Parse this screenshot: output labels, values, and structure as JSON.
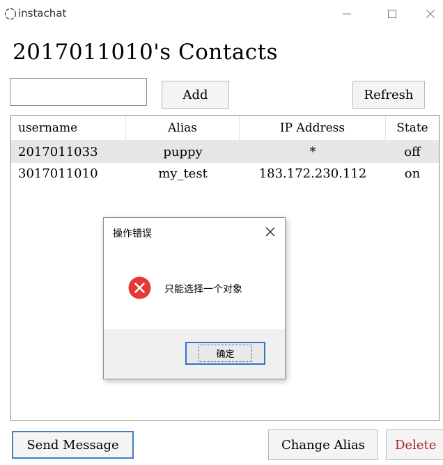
{
  "window": {
    "title": "instachat",
    "icon": "app-ring-icon",
    "controls": {
      "minimize": "minimize-icon",
      "maximize": "maximize-icon",
      "close": "close-icon"
    }
  },
  "page": {
    "title": "2017011010's Contacts"
  },
  "toolbar": {
    "input_value": "",
    "add_label": "Add",
    "refresh_label": "Refresh"
  },
  "table": {
    "headers": [
      "username",
      "Alias",
      "IP Address",
      "State"
    ],
    "rows": [
      {
        "username": "2017011033",
        "alias": "puppy",
        "ip": "*",
        "state": "off",
        "selected": true
      },
      {
        "username": "3017011010",
        "alias": "my_test",
        "ip": "183.172.230.112",
        "state": "on",
        "selected": false
      }
    ]
  },
  "actions": {
    "send_label": "Send Message",
    "change_alias_label": "Change Alias",
    "delete_label": "Delete"
  },
  "dialog": {
    "title": "操作错误",
    "message": "只能选择一个对象",
    "ok_label": "确定",
    "icon": "error-icon"
  },
  "colors": {
    "accent_blue": "#3b7fc4",
    "error_red": "#e53935",
    "delete_red": "#b22222",
    "selected_row": "#e6e6e6"
  }
}
